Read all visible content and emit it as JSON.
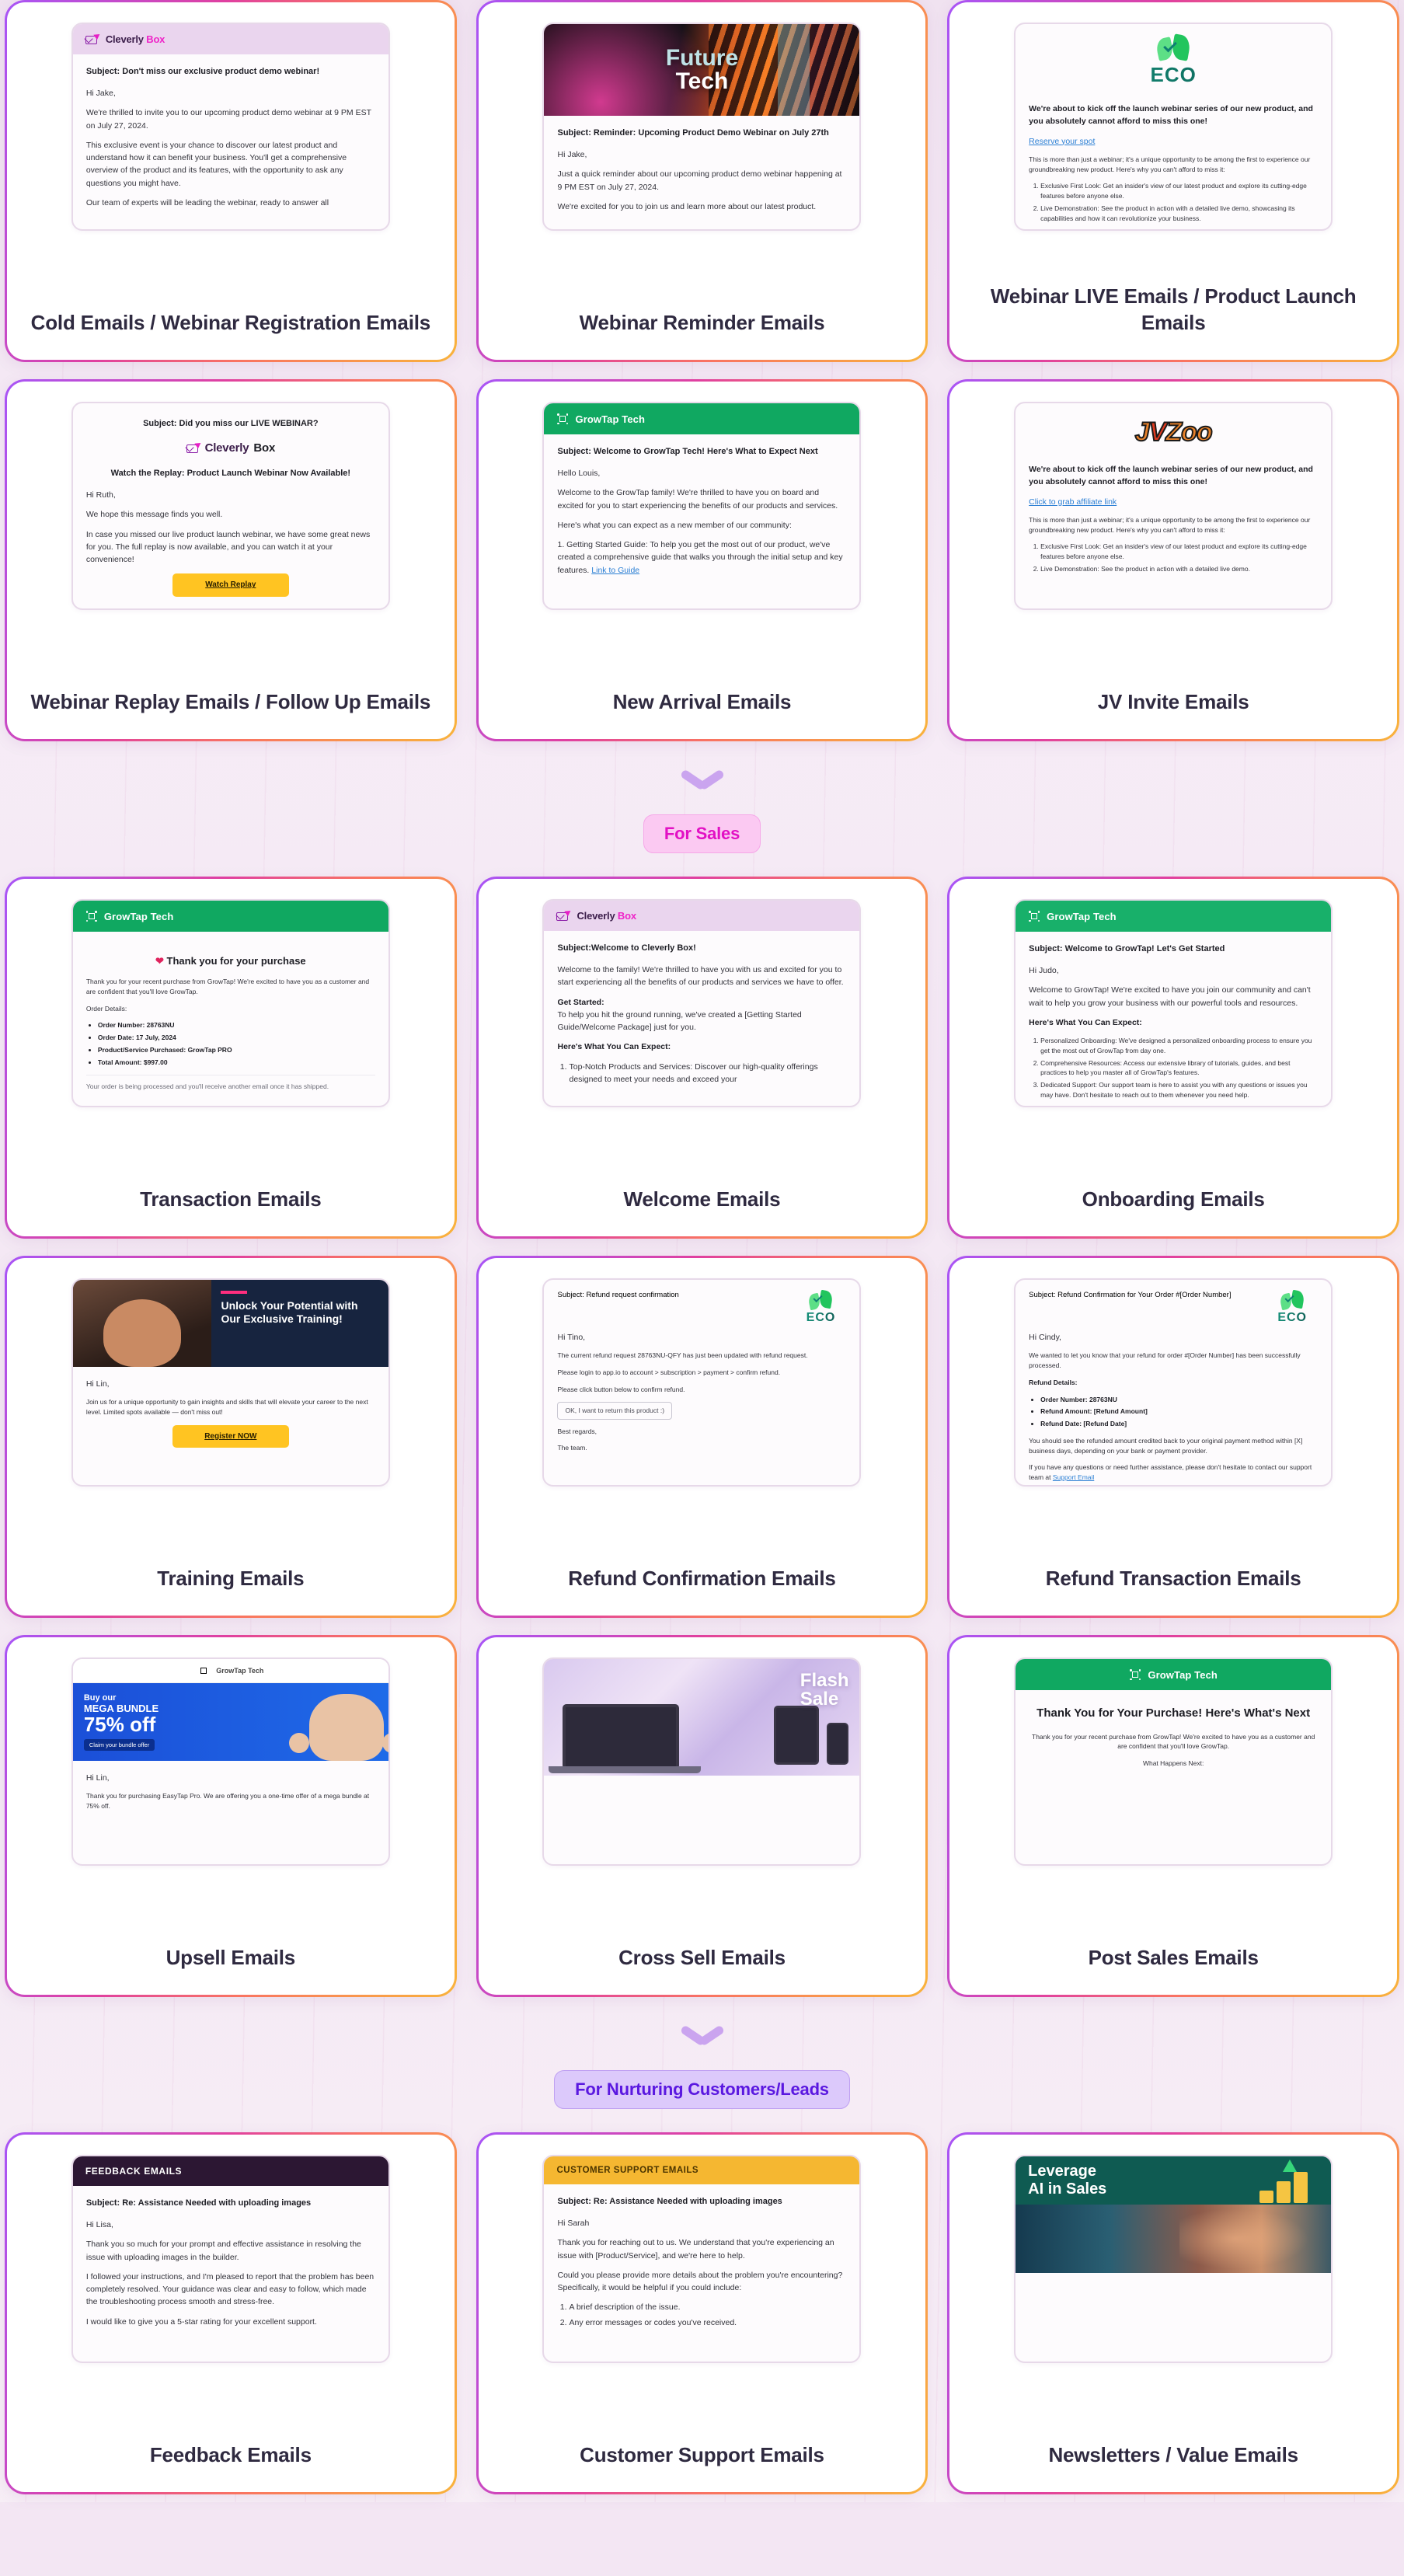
{
  "page": {
    "title": "Email Templates Gallery"
  },
  "sections": [
    {
      "id": "section-top",
      "badge": null,
      "rows": [
        {
          "cards": [
            {
              "title": "Cold Emails / Webinar Registration Emails",
              "preview": {
                "kind": "cleverly-header",
                "brand_primary": "Cleverly",
                "brand_accent": "Box",
                "subject": "Subject: Don't miss our exclusive product demo webinar!",
                "greeting": "Hi Jake,",
                "paragraphs": [
                  "We're thrilled to invite you to our upcoming product demo webinar at 9 PM EST on July 27, 2024.",
                  "This exclusive event is your chance to discover our latest product and understand how it can benefit your business. You'll get a comprehensive overview of the product and its features, with the opportunity to ask any questions you might have.",
                  "Our team of experts will be leading the webinar, ready to answer all"
                ]
              }
            },
            {
              "title": "Webinar Reminder Emails",
              "preview": {
                "kind": "future-tech-hero",
                "hero_line1": "Future",
                "hero_line2": "Tech",
                "subject": "Subject: Reminder: Upcoming Product Demo Webinar on July 27th",
                "greeting": "Hi Jake,",
                "paragraphs": [
                  "Just a quick reminder about our upcoming product demo webinar happening at 9 PM EST on July 27, 2024.",
                  "We're excited for you to join us and learn more about our latest product."
                ]
              }
            },
            {
              "title": "Webinar LIVE Emails / Product Launch Emails",
              "preview": {
                "kind": "eco-logo",
                "logo_word": "ECO",
                "headline": "We're about to kick off the launch webinar series of our new product, and you absolutely cannot afford to miss this one!",
                "link": "Reserve your spot",
                "subnote": "This is more than just a webinar; it's a unique opportunity to be among the first to experience our groundbreaking new product. Here's why you can't afford to miss it:",
                "bullets": [
                  "Exclusive First Look: Get an insider's view of our latest product and explore its cutting-edge features before anyone else.",
                  "Live Demonstration: See the product in action with a detailed live demo, showcasing its capabilities and how it can revolutionize your business."
                ]
              }
            }
          ]
        },
        {
          "cards": [
            {
              "title": "Webinar Replay Emails / Follow Up Emails",
              "preview": {
                "kind": "replay",
                "subject": "Subject: Did you miss our LIVE WEBINAR?",
                "brand_primary": "Cleverly",
                "brand_accent": "Box",
                "headline": "Watch the Replay: Product Launch Webinar Now Available!",
                "greeting": "Hi Ruth,",
                "paragraphs": [
                  "We hope this message finds you well.",
                  "In case you missed our live product launch webinar, we have some great news for you. The full replay is now available, and you can watch it at your convenience!"
                ],
                "cta": "Watch Replay"
              }
            },
            {
              "title": "New Arrival Emails",
              "preview": {
                "kind": "growtap-header",
                "brand": "GrowTap Tech",
                "subject": "Subject: Welcome to GrowTap Tech! Here's What to Expect Next",
                "greeting": "Hello Louis,",
                "paragraphs": [
                  "Welcome to the GrowTap family! We're thrilled to have you on board and excited for you to start experiencing the benefits of our products and services.",
                  "Here's what you can expect as a new member of our community:",
                  "1. Getting Started Guide: To help you get the most out of our product, we've created a comprehensive guide that walks you through the initial setup and key features."
                ],
                "link": "Link to Guide"
              }
            },
            {
              "title": "JV Invite Emails",
              "preview": {
                "kind": "jvzoo-logo",
                "logo_text_1": "J",
                "logo_text_v": "V",
                "logo_text_2": "Zoo",
                "headline": "We're about to kick off the launch webinar series of our new product, and you absolutely cannot afford to miss this one!",
                "link": "Click to grab affiliate link",
                "subnote": "This is more than just a webinar; it's a unique opportunity to be among the first to experience our groundbreaking new product. Here's why you can't afford to miss it:",
                "bullets": [
                  "Exclusive First Look: Get an insider's view of our latest product and explore its cutting-edge features before anyone else.",
                  "Live Demonstration: See the product in action with a detailed live demo."
                ]
              }
            }
          ]
        }
      ]
    },
    {
      "id": "section-sales",
      "badge": {
        "label": "For Sales",
        "style": "pink"
      },
      "rows": [
        {
          "cards": [
            {
              "title": "Transaction Emails",
              "preview": {
                "kind": "transaction",
                "brand": "GrowTap Tech",
                "headline": "Thank you for your purchase",
                "intro": "Thank you for your recent purchase from GrowTap! We're excited to have you as a customer and are confident that you'll love GrowTap.",
                "details_label": "Order Details:",
                "details": [
                  "Order Number: 28763NU",
                  "Order Date: 17 July, 2024",
                  "Product/Service Purchased: GrowTap PRO",
                  "Total Amount: $997.00"
                ],
                "footer": "Your order is being processed and you'll receive another email once it has shipped."
              }
            },
            {
              "title": "Welcome Emails",
              "preview": {
                "kind": "welcome",
                "brand_primary": "Cleverly",
                "brand_accent": "Box",
                "subject": "Subject:Welcome to Cleverly Box!",
                "paragraphs": [
                  "Welcome to the family! We're thrilled to have you with us and excited for you to start experiencing all the benefits of our products and services we have to offer."
                ],
                "sub1_label": "Get Started:",
                "sub1_text": "To help you hit the ground running, we've created a [Getting Started Guide/Welcome Package] just for you.",
                "sub2_label": "Here's What You Can Expect:",
                "list": [
                  "Top-Notch Products and Services: Discover our high-quality offerings designed to meet your needs and exceed your"
                ]
              }
            },
            {
              "title": "Onboarding Emails",
              "preview": {
                "kind": "onboarding",
                "brand": "GrowTap Tech",
                "subject": "Subject: Welcome to GrowTap! Let's Get Started",
                "greeting": "Hi Judo,",
                "paragraphs": [
                  "Welcome to GrowTap! We're excited to have you join our community and can't wait to help you grow your business with our powerful tools and resources.",
                  "Here's What You Can Expect:"
                ],
                "list": [
                  "Personalized Onboarding: We've designed a personalized onboarding process to ensure you get the most out of GrowTap from day one.",
                  "Comprehensive Resources: Access our extensive library of tutorials, guides, and best practices to help you master all of GrowTap's features.",
                  "Dedicated Support: Our support team is here to assist you with any questions or issues you may have. Don't hesitate to reach out to them whenever you need help."
                ]
              }
            }
          ]
        },
        {
          "cards": [
            {
              "title": "Training Emails",
              "preview": {
                "kind": "training",
                "hero_title": "Unlock Your Potential with Our Exclusive Training!",
                "greeting": "Hi Lin,",
                "paragraphs": [
                  "Join us for a unique opportunity to gain insights and skills that will elevate your career to the next level. Limited spots available — don't miss out!"
                ],
                "cta": "Register NOW"
              }
            },
            {
              "title": "Refund Confirmation Emails",
              "preview": {
                "kind": "refund-confirm",
                "logo_word": "ECO",
                "subject": "Subject: Refund request confirmation",
                "greeting": "Hi Tino,",
                "paragraphs": [
                  "The current refund request 28763NU-QFY has just been updated with refund request.",
                  "Please login to app.io to account > subscription > payment > confirm refund.",
                  "Please click button below to confirm refund."
                ],
                "button": "OK, I want to return this product :)",
                "signoff": "Best regards,",
                "signature": "The team."
              }
            },
            {
              "title": "Refund Transaction Emails",
              "preview": {
                "kind": "refund-transaction",
                "logo_word": "ECO",
                "subject": "Subject: Refund Confirmation for Your Order #[Order Number]",
                "greeting": "Hi Cindy,",
                "paragraphs": [
                  "We wanted to let you know that your refund for order #[Order Number] has been successfully processed."
                ],
                "details_label": "Refund Details:",
                "details": [
                  "Order Number: 28763NU",
                  "Refund Amount: [Refund Amount]",
                  "Refund Date: [Refund Date]"
                ],
                "closing": "You should see the refunded amount credited back to your original payment method within [X] business days, depending on your bank or payment provider.",
                "help_text": "If you have any questions or need further assistance, please don't hesitate to contact our support team at",
                "help_link": "Support Email"
              }
            }
          ]
        },
        {
          "cards": [
            {
              "title": "Upsell Emails",
              "preview": {
                "kind": "upsell",
                "brand": "GrowTap Tech",
                "hero_line1": "Buy our",
                "hero_line2": "MEGA BUNDLE",
                "hero_line3": "75% off",
                "hero_cta": "Claim your bundle offer",
                "greeting": "Hi Lin,",
                "paragraphs": [
                  "Thank you for purchasing EasyTap Pro. We are offering you a one-time offer of a mega bundle at 75% off."
                ]
              }
            },
            {
              "title": "Cross Sell Emails",
              "preview": {
                "kind": "cross-sell",
                "hero_line1": "Flash",
                "hero_line2": "Sale"
              }
            },
            {
              "title": "Post Sales Emails",
              "preview": {
                "kind": "post-sales",
                "brand": "GrowTap Tech",
                "headline": "Thank You for Your Purchase! Here's What's Next",
                "paragraphs": [
                  "Thank you for your recent purchase from GrowTap! We're excited to have you as a customer and are confident that you'll love GrowTap."
                ],
                "sub_label": "What Happens Next:"
              }
            }
          ]
        }
      ]
    },
    {
      "id": "section-nurture",
      "badge": {
        "label": "For Nurturing Customers/Leads",
        "style": "purple"
      },
      "rows": [
        {
          "cards": [
            {
              "title": "Feedback Emails",
              "preview": {
                "kind": "feedback",
                "header_label": "FEEDBACK EMAILS",
                "subject": "Subject: Re: Assistance Needed with uploading images",
                "greeting": "Hi Lisa,",
                "paragraphs": [
                  "Thank you so much for your prompt and effective assistance in resolving the issue with uploading images in the builder.",
                  "I followed your instructions, and I'm pleased to report that the problem has been completely resolved. Your guidance was clear and easy to follow, which made the troubleshooting process smooth and stress-free.",
                  "I would like to give you a 5-star rating for your excellent support."
                ]
              }
            },
            {
              "title": "Customer Support Emails",
              "preview": {
                "kind": "customer-support",
                "header_label": "CUSTOMER SUPPORT EMAILS",
                "subject": "Subject: Re: Assistance Needed with uploading images",
                "greeting": "Hi Sarah",
                "paragraphs": [
                  "Thank you for reaching out to us. We understand that you're experiencing an issue with [Product/Service], and we're here to help.",
                  "Could you please provide more details about the problem you're encountering? Specifically, it would be helpful if you could include:"
                ],
                "list": [
                  "A brief description of the issue.",
                  "Any error messages or codes you've received."
                ]
              }
            },
            {
              "title": "Newsletters / Value Emails",
              "preview": {
                "kind": "newsletter",
                "hero_line1": "Leverage",
                "hero_line2": "AI in Sales"
              }
            }
          ]
        }
      ]
    }
  ]
}
